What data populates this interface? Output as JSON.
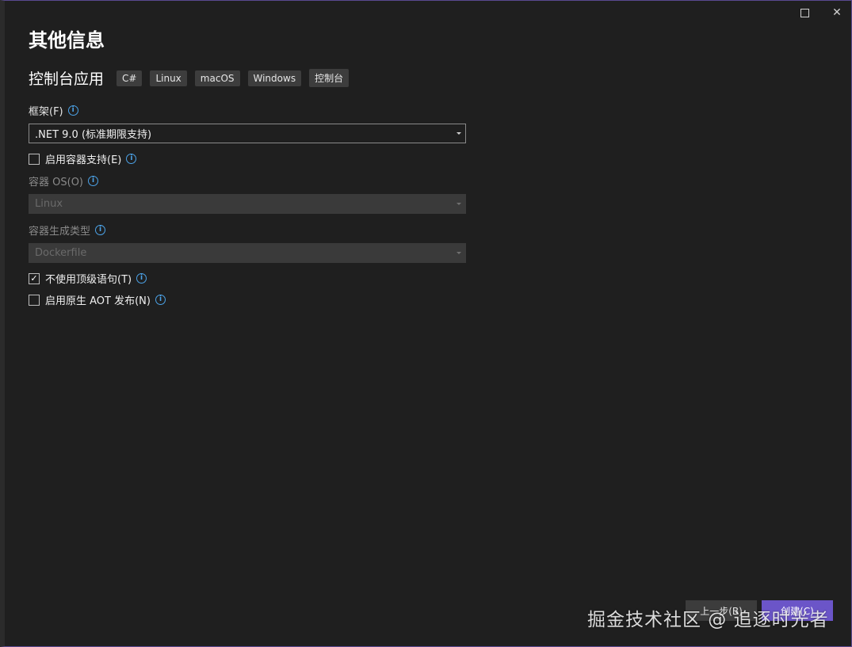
{
  "dialog": {
    "title": "其他信息",
    "project_type": "控制台应用",
    "tags": [
      "C#",
      "Linux",
      "macOS",
      "Windows",
      "控制台"
    ]
  },
  "framework": {
    "label": "框架(F)",
    "value": ".NET 9.0 (标准期限支持)"
  },
  "container_support": {
    "label": "启用容器支持(E)",
    "checked": false
  },
  "container_os": {
    "label": "容器 OS(O)",
    "value": "Linux",
    "enabled": false
  },
  "container_build_type": {
    "label": "容器生成类型",
    "value": "Dockerfile",
    "enabled": false
  },
  "top_level_statements": {
    "label": "不使用顶级语句(T)",
    "checked": true
  },
  "native_aot": {
    "label": "启用原生 AOT 发布(N)",
    "checked": false
  },
  "buttons": {
    "back": "上一步(B)",
    "create": "创建(C)"
  },
  "watermark": "掘金技术社区 @ 追逐时光者",
  "colors": {
    "background": "#1f1f1f",
    "accent": "#6b55c8",
    "info": "#4ca3e8"
  }
}
